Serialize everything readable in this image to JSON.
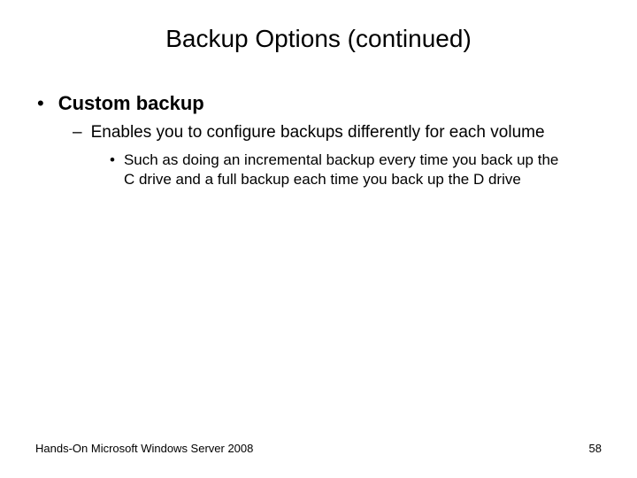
{
  "title": "Backup Options (continued)",
  "bullets": {
    "l1_text": "Custom backup",
    "l2_text": "Enables you to configure backups differently for each volume",
    "l3_text": "Such as doing an incremental backup every time you back up the C drive and a full backup each time you back up the D drive"
  },
  "markers": {
    "l1": "•",
    "l2": "–",
    "l3": "•"
  },
  "footer": {
    "left": "Hands-On Microsoft Windows Server 2008",
    "right": "58"
  }
}
